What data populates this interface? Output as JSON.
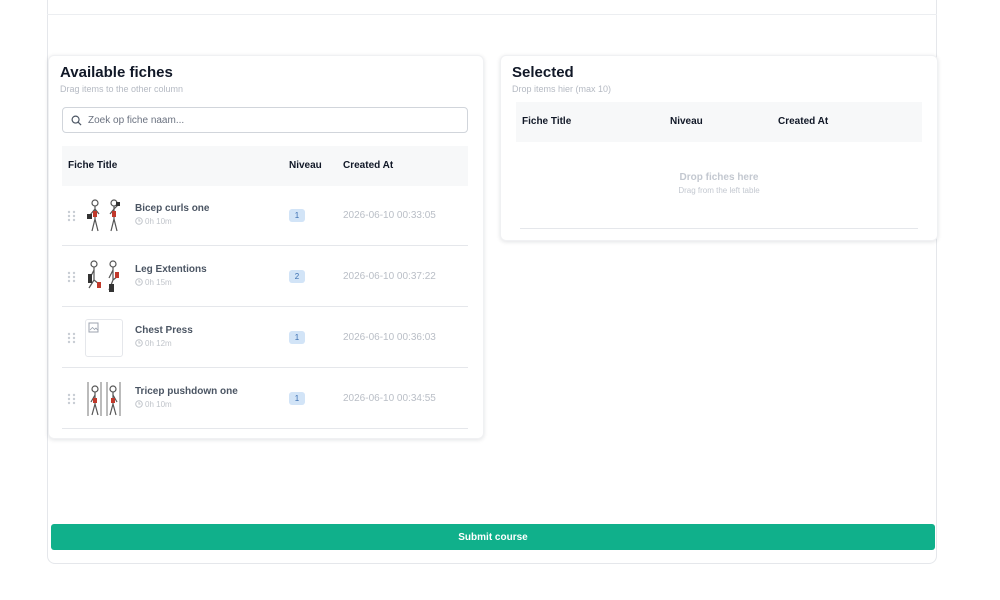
{
  "available": {
    "title": "Available fiches",
    "subtitle": "Drag items to the other column",
    "search_placeholder": "Zoek op fiche naam...",
    "columns": [
      "Fiche Title",
      "Niveau",
      "Created At"
    ],
    "rows": [
      {
        "title": "Bicep curls one",
        "duration": "0h 10m",
        "level": "1",
        "created": "2026-06-10 00:33:05"
      },
      {
        "title": "Leg Extentions",
        "duration": "0h 15m",
        "level": "2",
        "created": "2026-06-10 00:37:22"
      },
      {
        "title": "Chest Press",
        "duration": "0h 12m",
        "level": "1",
        "created": "2026-06-10 00:36:03"
      },
      {
        "title": "Tricep pushdown one",
        "duration": "0h 10m",
        "level": "1",
        "created": "2026-06-10 00:34:55"
      }
    ]
  },
  "selected": {
    "title": "Selected",
    "subtitle": "Drop items hier (max 10)",
    "columns": [
      "Fiche Title",
      "Niveau",
      "Created At"
    ],
    "empty_title": "Drop fiches here",
    "empty_subtitle": "Drag from the left table"
  },
  "submit_label": "Submit course",
  "colors": {
    "accent": "#10b08b",
    "badge_bg": "#d2e4f7",
    "badge_text": "#3b6fb0"
  },
  "icons": {
    "search": "search-icon",
    "grip": "drag-handle-icon",
    "clock": "clock-icon"
  }
}
